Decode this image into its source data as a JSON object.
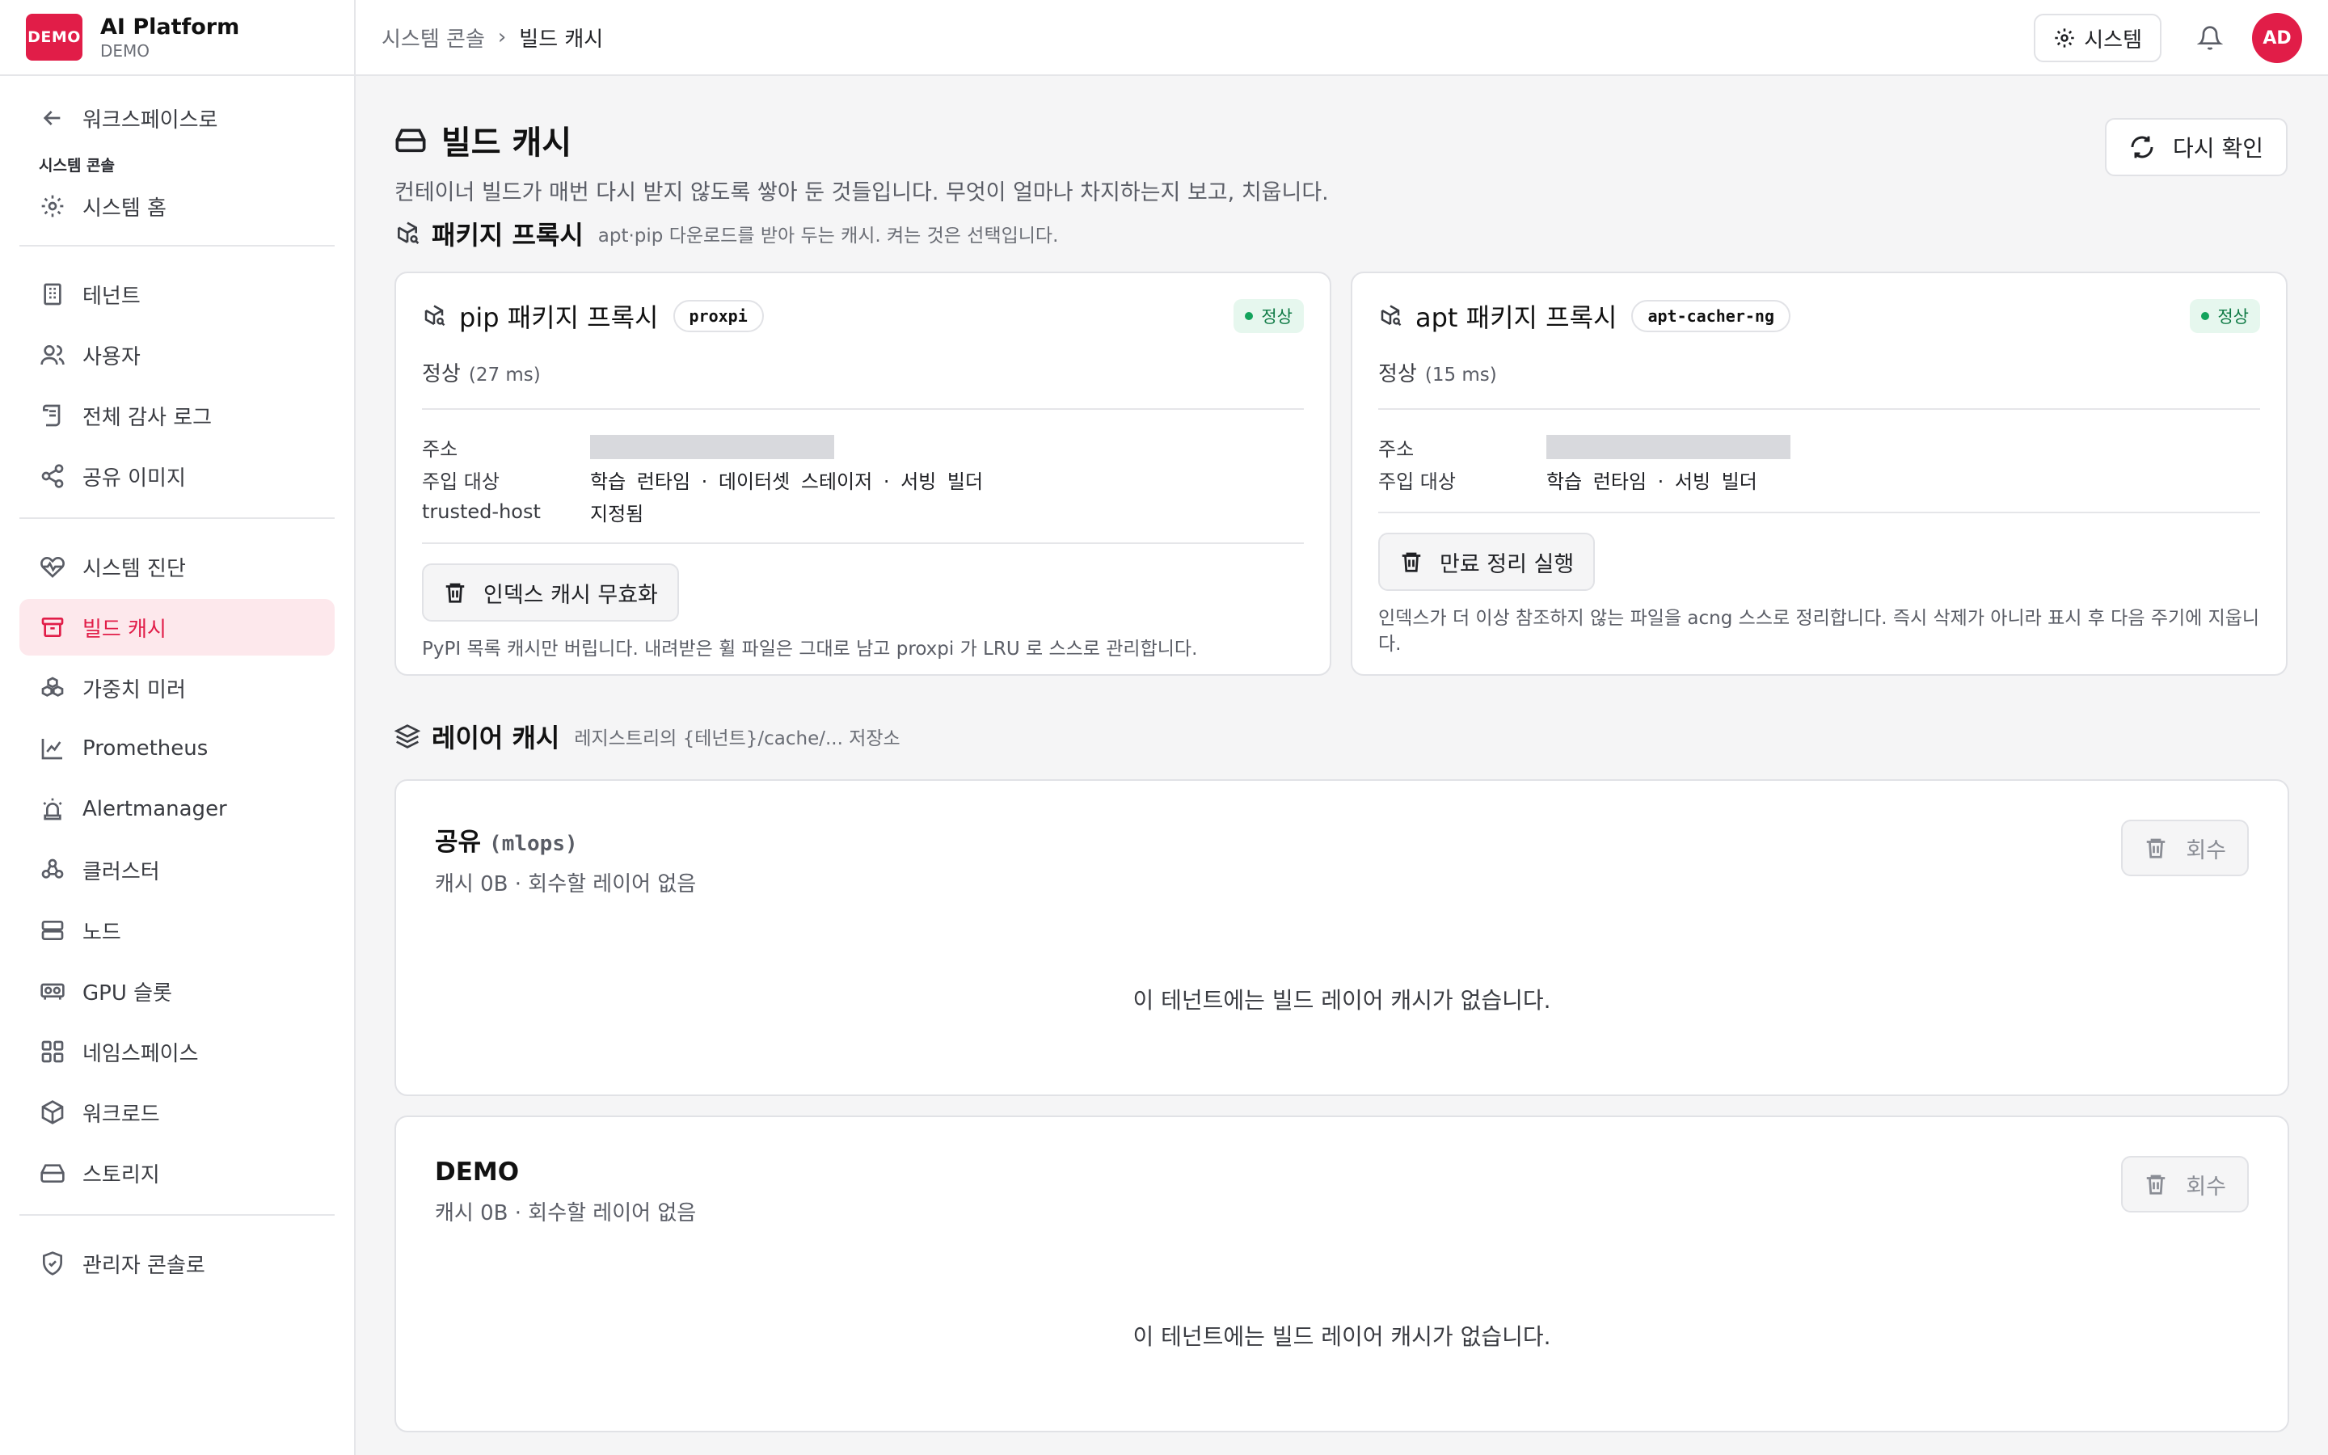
{
  "brand": {
    "logo_text": "DEMO",
    "name": "AI Platform",
    "sub": "DEMO"
  },
  "sidebar": {
    "back": "워크스페이스로",
    "section_label": "시스템 콘솔",
    "home": "시스템 홈",
    "items": [
      {
        "label": "테넌트",
        "icon": "building-icon"
      },
      {
        "label": "사용자",
        "icon": "users-icon"
      },
      {
        "label": "전체 감사 로그",
        "icon": "scroll-icon"
      },
      {
        "label": "공유 이미지",
        "icon": "share-icon"
      },
      {
        "label": "시스템 진단",
        "icon": "heart-pulse-icon"
      },
      {
        "label": "빌드 캐시",
        "icon": "archive-icon"
      },
      {
        "label": "가중치 미러",
        "icon": "boxes-icon"
      },
      {
        "label": "Prometheus",
        "icon": "line-chart-icon"
      },
      {
        "label": "Alertmanager",
        "icon": "siren-icon"
      },
      {
        "label": "클러스터",
        "icon": "cluster-icon"
      },
      {
        "label": "노드",
        "icon": "server-icon"
      },
      {
        "label": "GPU 슬롯",
        "icon": "gpu-icon"
      },
      {
        "label": "네임스페이스",
        "icon": "grid-icon"
      },
      {
        "label": "워크로드",
        "icon": "package-icon"
      },
      {
        "label": "스토리지",
        "icon": "hard-drive-icon"
      }
    ],
    "admin": "관리자 콘솔로"
  },
  "topbar": {
    "breadcrumb_parent": "시스템 콘솔",
    "breadcrumb_current": "빌드 캐시",
    "system_button": "시스템",
    "avatar": "AD"
  },
  "page": {
    "title": "빌드 캐시",
    "description": "컨테이너 빌드가 매번 다시 받지 않도록 쌓아 둔 것들입니다. 무엇이 얼마나 차지하는지 보고, 치웁니다.",
    "recheck_button": "다시 확인"
  },
  "package_proxy": {
    "title": "패키지 프록시",
    "subtitle": "apt·pip 다운로드를 받아 두는 캐시. 켜는 것은 선택입니다.",
    "cards": [
      {
        "title": "pip 패키지 프록시",
        "code": "proxpi",
        "status": "정상",
        "state": "정상",
        "latency": "(27 ms)",
        "address_label": "주소",
        "inject_label": "주입 대상",
        "inject_value": "학습 런타임 · 데이터셋 스테이저 · 서빙 빌더",
        "trusted_label": "trusted-host",
        "trusted_value": "지정됨",
        "action": "인덱스 캐시 무효화",
        "note": "PyPI 목록 캐시만 버립니다. 내려받은 휠 파일은 그대로 남고 proxpi 가 LRU 로 스스로 관리합니다."
      },
      {
        "title": "apt 패키지 프록시",
        "code": "apt-cacher-ng",
        "status": "정상",
        "state": "정상",
        "latency": "(15 ms)",
        "address_label": "주소",
        "inject_label": "주입 대상",
        "inject_value": "학습 런타임 · 서빙 빌더",
        "action": "만료 정리 실행",
        "note": "인덱스가 더 이상 참조하지 않는 파일을 acng 스스로 정리합니다. 즉시 삭제가 아니라 표시 후 다음 주기에 지웁니다."
      }
    ]
  },
  "layer_cache": {
    "title": "레이어 캐시",
    "subtitle": "레지스트리의 {테넌트}/cache/... 저장소",
    "cards": [
      {
        "title": "공유",
        "code": "(mlops)",
        "sub": "캐시 0B · 회수할 레이어 없음",
        "button": "회수",
        "empty": "이 테넌트에는 빌드 레이어 캐시가 없습니다."
      },
      {
        "title": "DEMO",
        "code": "",
        "sub": "캐시 0B · 회수할 레이어 없음",
        "button": "회수",
        "empty": "이 테넌트에는 빌드 레이어 캐시가 없습니다."
      }
    ]
  },
  "colors": {
    "accent": "#e11d48",
    "ok_bg": "#e6f7ee",
    "ok_text": "#0f7a45"
  }
}
